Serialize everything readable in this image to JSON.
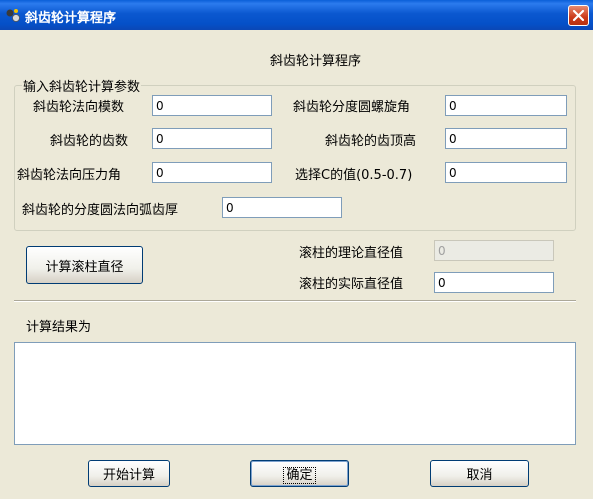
{
  "window": {
    "title": "斜齿轮计算程序"
  },
  "header": {
    "title": "斜齿轮计算程序"
  },
  "group": {
    "legend": "输入斜齿轮计算参数"
  },
  "fields": {
    "normal_module": {
      "label": "斜齿轮法向模数",
      "value": "0"
    },
    "helix_angle": {
      "label": "斜齿轮分度圆螺旋角",
      "value": "0"
    },
    "teeth_count": {
      "label": "斜齿轮的齿数",
      "value": "0"
    },
    "addendum": {
      "label": "斜齿轮的齿顶高",
      "value": "0"
    },
    "pressure_angle": {
      "label": "斜齿轮法向压力角",
      "value": "0"
    },
    "c_value": {
      "label": "选择C的值(0.5-0.7)",
      "value": "0"
    },
    "tooth_thickness": {
      "label": "斜齿轮的分度圆法向弧齿厚",
      "value": "0"
    }
  },
  "roller": {
    "calc_button": "计算滚柱直径",
    "theory_label": "滚柱的理论直径值",
    "theory_value": "0",
    "actual_label": "滚柱的实际直径值",
    "actual_value": "0"
  },
  "result": {
    "label": "计算结果为",
    "text": ""
  },
  "buttons": {
    "start": "开始计算",
    "ok": "确定",
    "cancel": "取消"
  },
  "icons": {
    "app": "gear-app-icon",
    "close": "close-icon"
  },
  "colors": {
    "titlebar": "#0A5FD8",
    "window_bg": "#ECE9D8",
    "close": "#CB3A1A"
  }
}
